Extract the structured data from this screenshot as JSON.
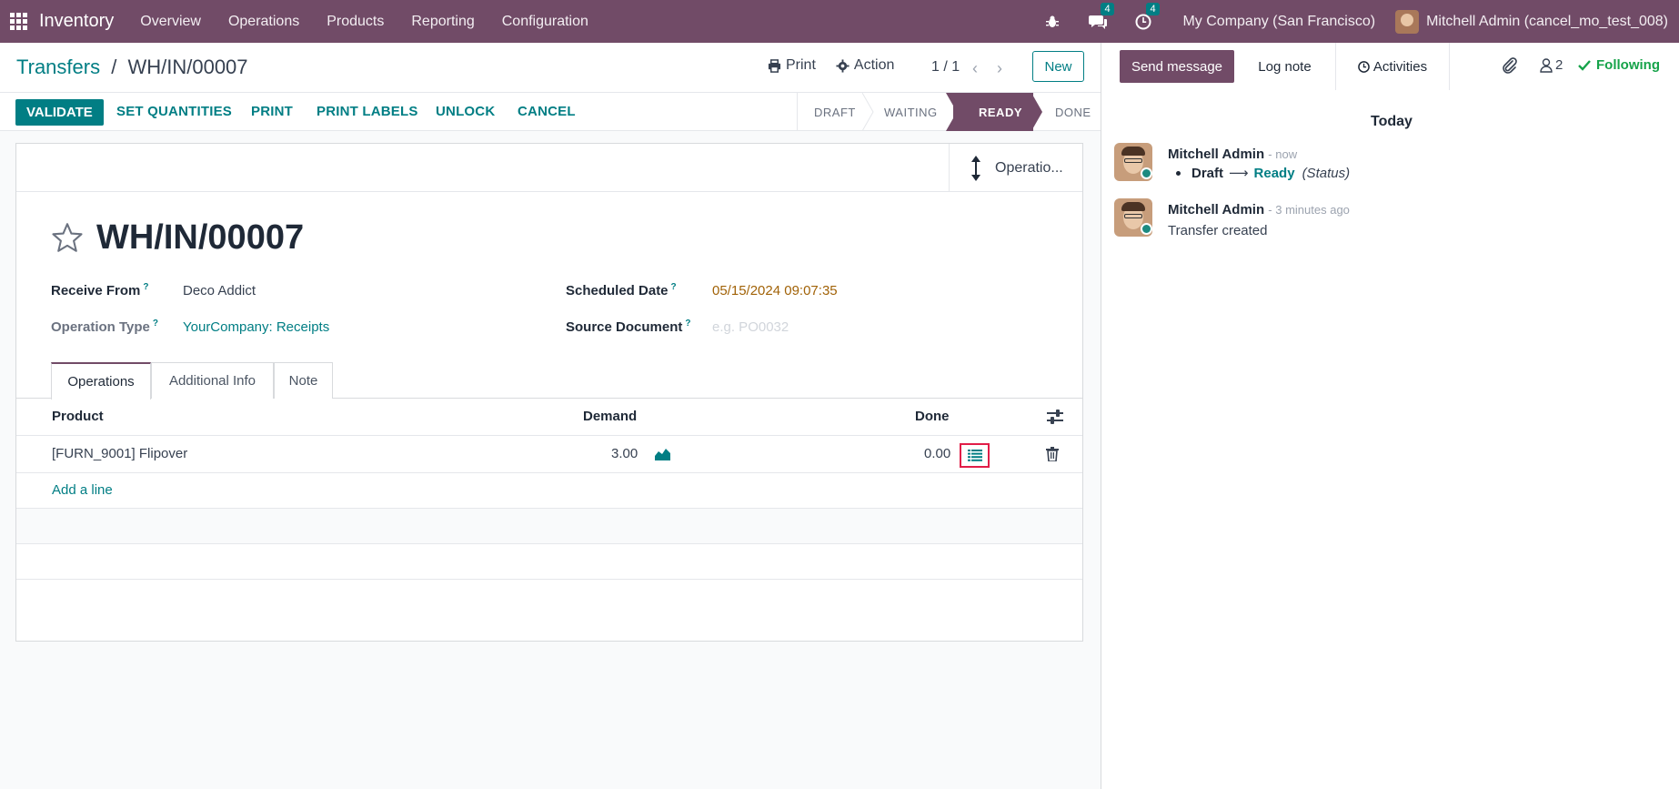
{
  "navbar": {
    "app_name": "Inventory",
    "menus": [
      "Overview",
      "Operations",
      "Products",
      "Reporting",
      "Configuration"
    ],
    "messages_badge": "4",
    "activities_badge": "4",
    "company": "My Company (San Francisco)",
    "user": "Mitchell Admin (cancel_mo_test_008)"
  },
  "control": {
    "breadcrumb_parent": "Transfers",
    "breadcrumb_sep": "/",
    "breadcrumb_current": "WH/IN/00007",
    "print_label": "Print",
    "action_label": "Action",
    "pager": "1 / 1",
    "new_label": "New"
  },
  "statusbar": {
    "validate": "VALIDATE",
    "buttons": [
      "SET QUANTITIES",
      "PRINT",
      "PRINT LABELS",
      "UNLOCK",
      "CANCEL"
    ],
    "stages": [
      "DRAFT",
      "WAITING",
      "READY",
      "DONE"
    ],
    "active_stage": "READY"
  },
  "form": {
    "smart_button": "Operatio...",
    "title": "WH/IN/00007",
    "receive_from_label": "Receive From",
    "receive_from": "Deco Addict",
    "operation_type_label": "Operation Type",
    "operation_type": "YourCompany: Receipts",
    "scheduled_date_label": "Scheduled Date",
    "scheduled_date": "05/15/2024 09:07:35",
    "source_document_label": "Source Document",
    "source_document_placeholder": "e.g. PO0032",
    "help_mark": "?",
    "tabs": [
      "Operations",
      "Additional Info",
      "Note"
    ],
    "columns": {
      "product": "Product",
      "demand": "Demand",
      "done": "Done"
    },
    "lines": [
      {
        "product": "[FURN_9001] Flipover",
        "demand": "3.00",
        "done": "0.00"
      }
    ],
    "add_line": "Add a line"
  },
  "chatter": {
    "send_message": "Send message",
    "log_note": "Log note",
    "activities": "Activities",
    "followers_count": "2",
    "following": "Following",
    "date_separator": "Today",
    "messages": [
      {
        "author": "Mitchell Admin",
        "time": "- now",
        "old_value": "Draft",
        "new_value": "Ready",
        "field": "(Status)"
      },
      {
        "author": "Mitchell Admin",
        "time": "- 3 minutes ago",
        "body": "Transfer created"
      }
    ]
  },
  "colors": {
    "brand": "#714B67",
    "accent": "#017E84",
    "highlight": "#e11d48"
  }
}
